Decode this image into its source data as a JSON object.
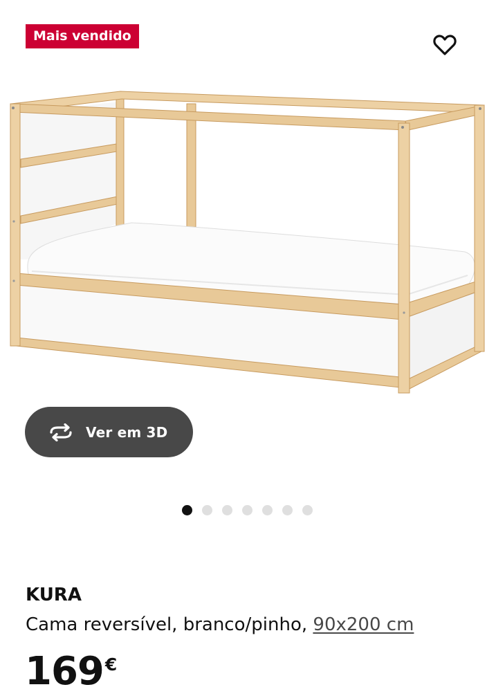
{
  "badge": {
    "label": "Mais vendido",
    "color": "#cc0033"
  },
  "favorite": {
    "icon": "heart-outline-icon"
  },
  "product_image": {
    "subject": "wooden loft bed frame with white panels and mattress"
  },
  "viewer_button": {
    "label": "Ver em 3D",
    "icon": "rotate-3d-icon"
  },
  "carousel": {
    "total": 7,
    "active_index": 0
  },
  "product": {
    "name": "KURA",
    "description": "Cama reversível, branco/pinho,",
    "size": "90x200 cm",
    "price": "169",
    "currency": "€"
  }
}
